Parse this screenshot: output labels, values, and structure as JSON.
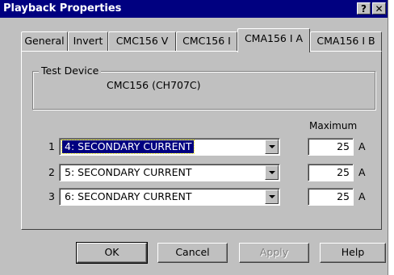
{
  "window": {
    "title": "Playback Properties",
    "help_label": "?",
    "close_label": "✕"
  },
  "tabs": [
    "General",
    "Invert",
    "CMC156 V",
    "CMC156 I",
    "CMA156 I A",
    "CMA156 I B"
  ],
  "active_tab": "CMA156 I A",
  "test_device": {
    "group_label": "Test Device",
    "value": "CMC156 (CH707C)"
  },
  "channels": {
    "max_header": "Maximum",
    "rows": [
      {
        "index": "1",
        "selection": "4: SECONDARY CURRENT",
        "max": "25",
        "unit": "A",
        "focused": true
      },
      {
        "index": "2",
        "selection": "5: SECONDARY CURRENT",
        "max": "25",
        "unit": "A",
        "focused": false
      },
      {
        "index": "3",
        "selection": "6: SECONDARY CURRENT",
        "max": "25",
        "unit": "A",
        "focused": false
      }
    ]
  },
  "buttons": {
    "ok": "OK",
    "cancel": "Cancel",
    "apply": "Apply",
    "help": "Help"
  },
  "colors": {
    "titlebar": "#000080",
    "face": "#c0c0c0",
    "selection": "#000080"
  }
}
